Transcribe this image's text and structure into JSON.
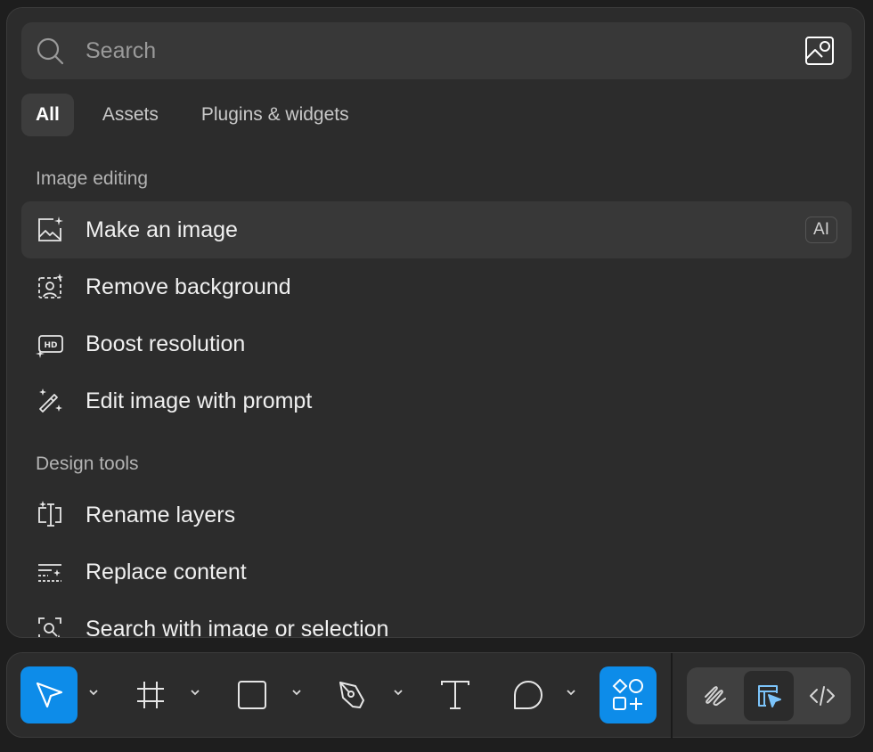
{
  "search": {
    "placeholder": "Search"
  },
  "tabs": [
    {
      "label": "All",
      "active": true
    },
    {
      "label": "Assets"
    },
    {
      "label": "Plugins & widgets"
    }
  ],
  "sections": [
    {
      "title": "Image editing",
      "items": [
        {
          "label": "Make an image",
          "icon": "image-sparkle-icon",
          "badge": "AI",
          "highlighted": true
        },
        {
          "label": "Remove background",
          "icon": "remove-background-icon"
        },
        {
          "label": "Boost resolution",
          "icon": "hd-sparkle-icon"
        },
        {
          "label": "Edit image with prompt",
          "icon": "magic-wand-icon"
        }
      ]
    },
    {
      "title": "Design tools",
      "items": [
        {
          "label": "Rename layers",
          "icon": "rename-layers-icon"
        },
        {
          "label": "Replace content",
          "icon": "replace-content-icon"
        },
        {
          "label": "Search with image or selection",
          "icon": "search-selection-icon"
        }
      ]
    }
  ],
  "toolbar": {
    "tools": [
      "move-tool",
      "frame-tool",
      "shape-tool",
      "pen-tool",
      "text-tool",
      "comment-tool",
      "actions-tool"
    ],
    "modes": [
      "draw-mode",
      "design-mode",
      "dev-mode"
    ],
    "active_tool": "move-tool",
    "active_mode": "design-mode"
  },
  "colors": {
    "accent": "#0d8ce9",
    "panel": "#2c2c2c",
    "highlight_row": "#383838"
  }
}
